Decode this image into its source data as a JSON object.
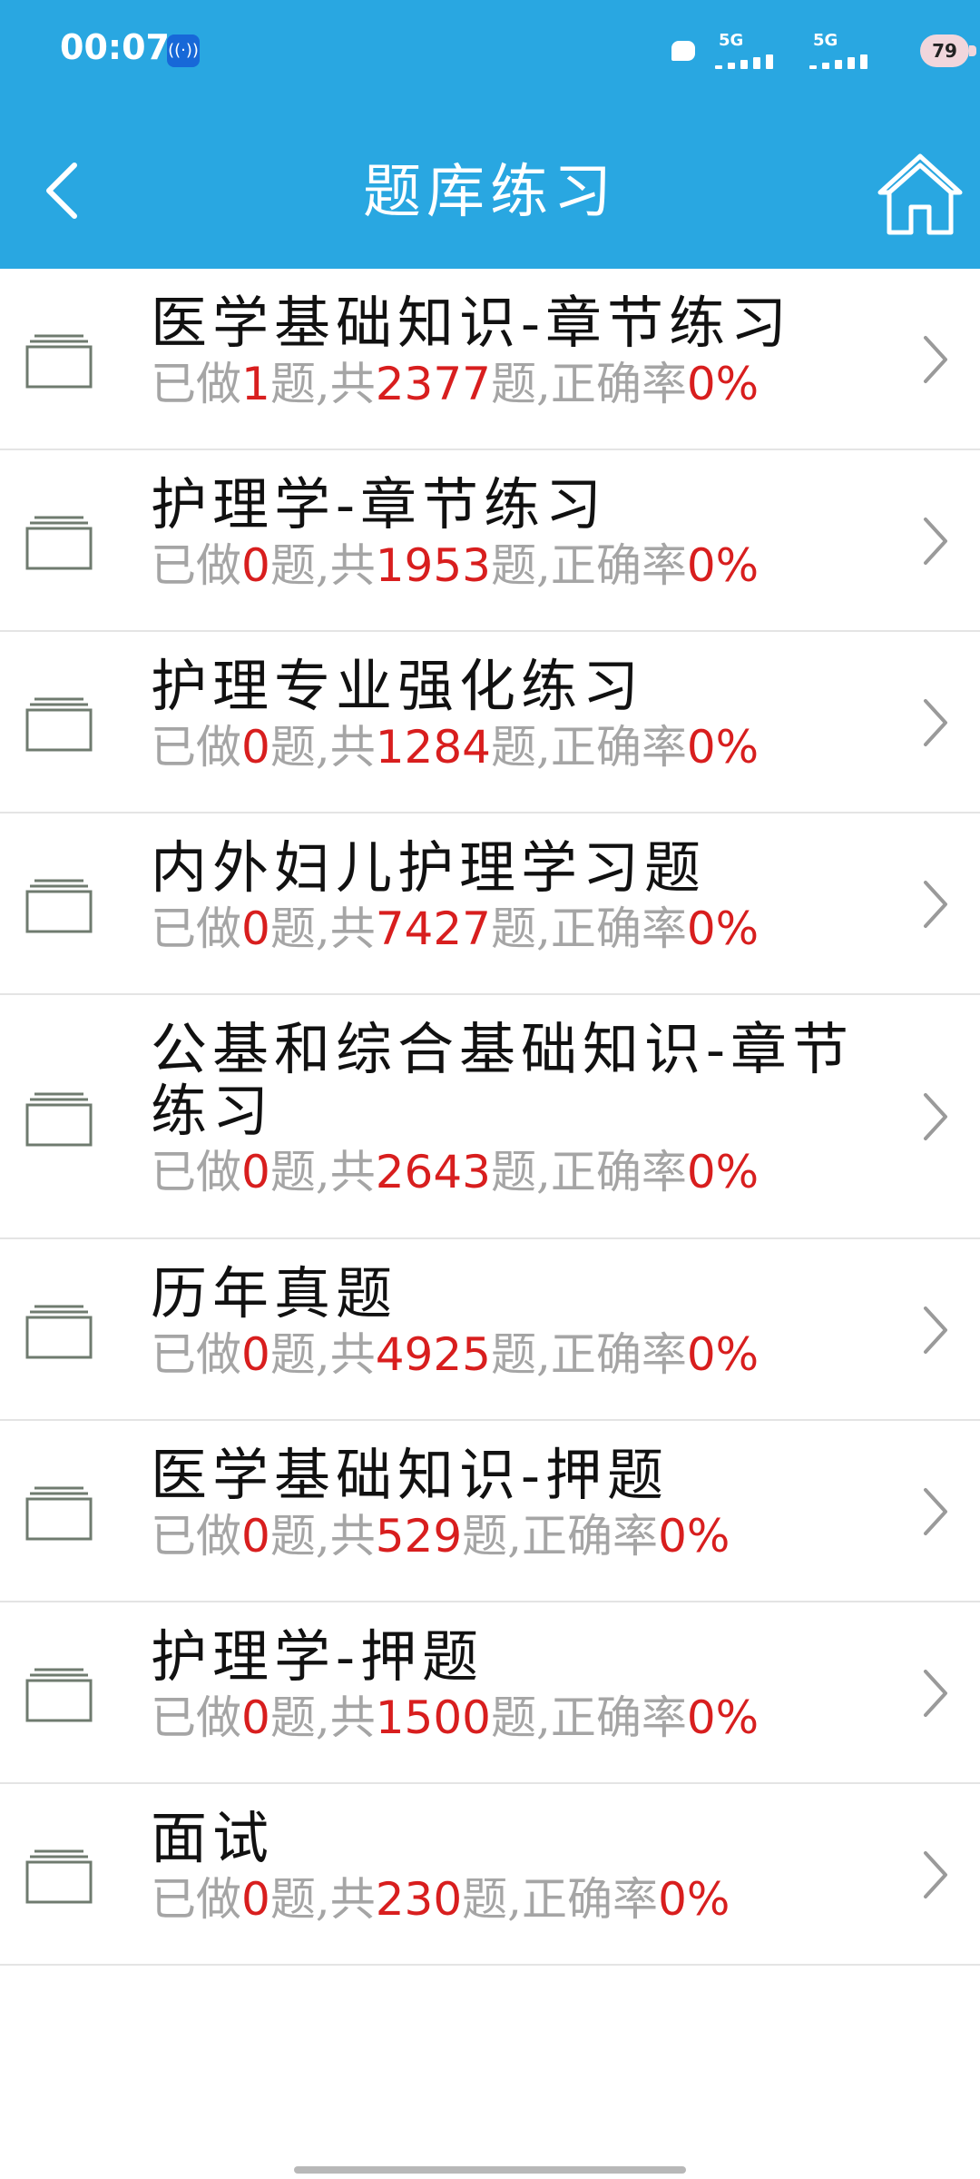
{
  "status_bar": {
    "time": "00:07",
    "signal_1_label": "5G",
    "signal_2_label": "5G",
    "battery": "79"
  },
  "header": {
    "title": "题库练习"
  },
  "list": [
    {
      "name": "医学基础知识-章节练习",
      "done": "1",
      "total": "2377",
      "accuracy": "0%"
    },
    {
      "name": "护理学-章节练习",
      "done": "0",
      "total": "1953",
      "accuracy": "0%"
    },
    {
      "name": "护理专业强化练习",
      "done": "0",
      "total": "1284",
      "accuracy": "0%"
    },
    {
      "name": "内外妇儿护理学习题",
      "done": "0",
      "total": "7427",
      "accuracy": "0%"
    },
    {
      "name": "公基和综合基础知识-章节练习",
      "done": "0",
      "total": "2643",
      "accuracy": "0%"
    },
    {
      "name": "历年真题",
      "done": "0",
      "total": "4925",
      "accuracy": "0%"
    },
    {
      "name": "医学基础知识-押题",
      "done": "0",
      "total": "529",
      "accuracy": "0%"
    },
    {
      "name": "护理学-押题",
      "done": "0",
      "total": "1500",
      "accuracy": "0%"
    },
    {
      "name": "面试",
      "done": "0",
      "total": "230",
      "accuracy": "0%"
    }
  ],
  "stat_text": {
    "prefix": "已做",
    "mid1": "题,共",
    "mid2": "题,正确率"
  },
  "colors": {
    "header_bg": "#29a7e1",
    "highlight_number": "#d81e1e",
    "secondary_text": "#a5a5a5"
  }
}
